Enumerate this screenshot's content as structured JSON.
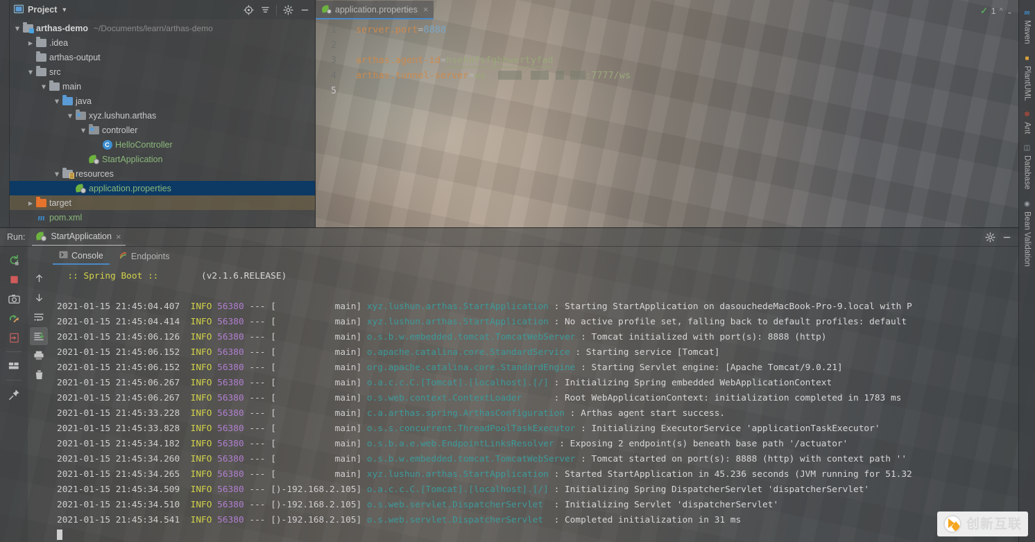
{
  "left_stripe": {
    "labels": []
  },
  "project": {
    "title": "Project",
    "dropdown_icon": "chevron-down-icon",
    "panel_icon": "project-panel-icon",
    "toolbar": [
      {
        "name": "locate-icon",
        "label": "locate"
      },
      {
        "name": "collapse-all-icon",
        "label": "collapse-all"
      },
      {
        "name": "gear-icon",
        "label": "settings"
      },
      {
        "name": "minimize-icon",
        "label": "hide"
      }
    ],
    "tree": [
      {
        "indent": 0,
        "arrow": "down",
        "icon": "module-folder-icon",
        "label": "arthas-demo",
        "sub": "~/Documents/learn/arthas-demo",
        "style": "root"
      },
      {
        "indent": 1,
        "arrow": "right",
        "icon": "folder-icon",
        "label": ".idea",
        "sub": "",
        "style": ""
      },
      {
        "indent": 1,
        "arrow": "none",
        "icon": "folder-icon",
        "label": "arthas-output",
        "sub": "",
        "style": ""
      },
      {
        "indent": 1,
        "arrow": "down",
        "icon": "folder-icon",
        "label": "src",
        "sub": "",
        "style": ""
      },
      {
        "indent": 2,
        "arrow": "down",
        "icon": "folder-icon",
        "label": "main",
        "sub": "",
        "style": ""
      },
      {
        "indent": 3,
        "arrow": "down",
        "icon": "source-folder-icon",
        "label": "java",
        "sub": "",
        "style": ""
      },
      {
        "indent": 4,
        "arrow": "down",
        "icon": "package-icon",
        "label": "xyz.lushun.arthas",
        "sub": "",
        "style": ""
      },
      {
        "indent": 5,
        "arrow": "down",
        "icon": "package-icon",
        "label": "controller",
        "sub": "",
        "style": ""
      },
      {
        "indent": 6,
        "arrow": "none",
        "icon": "java-class-icon",
        "label": "HelloController",
        "sub": "",
        "style": "green"
      },
      {
        "indent": 5,
        "arrow": "none",
        "icon": "spring-bean-icon",
        "label": "StartApplication",
        "sub": "",
        "style": "green"
      },
      {
        "indent": 3,
        "arrow": "down",
        "icon": "resources-folder-icon",
        "label": "resources",
        "sub": "",
        "style": ""
      },
      {
        "indent": 4,
        "arrow": "none",
        "icon": "spring-properties-icon",
        "label": "application.properties",
        "sub": "",
        "style": "selected"
      },
      {
        "indent": 1,
        "arrow": "right",
        "icon": "excluded-folder-icon",
        "label": "target",
        "sub": "",
        "style": "highlight"
      },
      {
        "indent": 1,
        "arrow": "none",
        "icon": "maven-icon",
        "label": "pom.xml",
        "sub": "",
        "style": "green"
      }
    ]
  },
  "editor": {
    "tab": {
      "icon": "spring-properties-icon",
      "name": "application.properties",
      "close": "×"
    },
    "inspection_widget": {
      "check_icon": "inspection-ok-icon",
      "count": "1",
      "up": "⌃",
      "down": "⌄"
    },
    "lines": [
      {
        "no": "1",
        "tokens": [
          {
            "t": "key",
            "v": "server.port"
          },
          {
            "t": "eq",
            "v": "="
          },
          {
            "t": "num",
            "v": "8888"
          }
        ]
      },
      {
        "no": "2",
        "tokens": []
      },
      {
        "no": "3",
        "tokens": [
          {
            "t": "key",
            "v": "arthas.agent-id"
          },
          {
            "t": "eq",
            "v": "="
          },
          {
            "t": "wavy",
            "v": "hsehdfsfghhwertyfad"
          }
        ]
      },
      {
        "no": "4",
        "tokens": [
          {
            "t": "key",
            "v": "arthas.tunnel-server"
          },
          {
            "t": "eq",
            "v": "="
          },
          {
            "t": "val",
            "v": "ws"
          },
          {
            "t": "redact",
            "v": ""
          },
          {
            "t": "val",
            "v": ":7777/ws"
          }
        ]
      },
      {
        "no": "5",
        "tokens": [],
        "current": true
      }
    ]
  },
  "run_panel": {
    "label": "Run:",
    "config": {
      "icon": "spring-boot-icon",
      "name": "StartApplication",
      "close": "×"
    },
    "header_right": [
      {
        "name": "gear-icon",
        "label": "settings"
      },
      {
        "name": "minimize-icon",
        "label": "hide"
      }
    ],
    "left_toolbar": [
      {
        "name": "rerun-icon",
        "label": "Rerun"
      },
      {
        "name": "stop-icon",
        "label": "Stop"
      },
      {
        "name": "camera-icon",
        "label": "Dump Threads"
      },
      {
        "name": "restart-icon",
        "label": "Restart"
      },
      {
        "name": "exit-icon",
        "label": "Exit"
      },
      {
        "name": "layout-icon",
        "label": "Layout"
      },
      {
        "name": "pin-icon",
        "label": "Pin Tab"
      }
    ],
    "second_toolbar": [
      {
        "name": "up-arrow-icon",
        "label": "Up the Stack Trace"
      },
      {
        "name": "down-arrow-icon",
        "label": "Down the Stack Trace"
      },
      {
        "name": "soft-wrap-icon",
        "label": "Soft-Wrap"
      },
      {
        "name": "scroll-end-icon",
        "label": "Scroll to End",
        "active": true
      },
      {
        "name": "print-icon",
        "label": "Print"
      },
      {
        "name": "trash-icon",
        "label": "Clear All"
      }
    ],
    "tabs": [
      {
        "icon": "console-icon",
        "label": "Console",
        "active": true
      },
      {
        "icon": "endpoints-icon",
        "label": "Endpoints",
        "active": false
      }
    ],
    "console": {
      "banner": {
        "text": ":: Spring Boot ::",
        "version": "(v2.1.6.RELEASE)"
      },
      "lines": [
        {
          "ts": "2021-01-15 21:45:04.407",
          "lvl": "INFO",
          "pid": "56380",
          "thread": "main",
          "logger": "xyz.lushun.arthas.StartApplication",
          "msg": "Starting StartApplication on dasouchedeMacBook-Pro-9.local with P"
        },
        {
          "ts": "2021-01-15 21:45:04.414",
          "lvl": "INFO",
          "pid": "56380",
          "thread": "main",
          "logger": "xyz.lushun.arthas.StartApplication",
          "msg": "No active profile set, falling back to default profiles: default"
        },
        {
          "ts": "2021-01-15 21:45:06.126",
          "lvl": "INFO",
          "pid": "56380",
          "thread": "main",
          "logger": "o.s.b.w.embedded.tomcat.TomcatWebServer",
          "msg": "Tomcat initialized with port(s): 8888 (http)"
        },
        {
          "ts": "2021-01-15 21:45:06.152",
          "lvl": "INFO",
          "pid": "56380",
          "thread": "main",
          "logger": "o.apache.catalina.core.StandardService",
          "msg": "Starting service [Tomcat]"
        },
        {
          "ts": "2021-01-15 21:45:06.152",
          "lvl": "INFO",
          "pid": "56380",
          "thread": "main",
          "logger": "org.apache.catalina.core.StandardEngine",
          "msg": "Starting Servlet engine: [Apache Tomcat/9.0.21]"
        },
        {
          "ts": "2021-01-15 21:45:06.267",
          "lvl": "INFO",
          "pid": "56380",
          "thread": "main",
          "logger": "o.a.c.c.C.[Tomcat].[localhost].[/]",
          "msg": "Initializing Spring embedded WebApplicationContext"
        },
        {
          "ts": "2021-01-15 21:45:06.267",
          "lvl": "INFO",
          "pid": "56380",
          "thread": "main",
          "logger": "o.s.web.context.ContextLoader",
          "msg": "Root WebApplicationContext: initialization completed in 1783 ms"
        },
        {
          "ts": "2021-01-15 21:45:33.228",
          "lvl": "INFO",
          "pid": "56380",
          "thread": "main",
          "logger": "c.a.arthas.spring.ArthasConfiguration",
          "msg": "Arthas agent start success."
        },
        {
          "ts": "2021-01-15 21:45:33.828",
          "lvl": "INFO",
          "pid": "56380",
          "thread": "main",
          "logger": "o.s.s.concurrent.ThreadPoolTaskExecutor",
          "msg": "Initializing ExecutorService 'applicationTaskExecutor'"
        },
        {
          "ts": "2021-01-15 21:45:34.182",
          "lvl": "INFO",
          "pid": "56380",
          "thread": "main",
          "logger": "o.s.b.a.e.web.EndpointLinksResolver",
          "msg": "Exposing 2 endpoint(s) beneath base path '/actuator'"
        },
        {
          "ts": "2021-01-15 21:45:34.260",
          "lvl": "INFO",
          "pid": "56380",
          "thread": "main",
          "logger": "o.s.b.w.embedded.tomcat.TomcatWebServer",
          "msg": "Tomcat started on port(s): 8888 (http) with context path ''"
        },
        {
          "ts": "2021-01-15 21:45:34.265",
          "lvl": "INFO",
          "pid": "56380",
          "thread": "main",
          "logger": "xyz.lushun.arthas.StartApplication",
          "msg": "Started StartApplication in 45.236 seconds (JVM running for 51.32"
        },
        {
          "ts": "2021-01-15 21:45:34.509",
          "lvl": "INFO",
          "pid": "56380",
          "thread": ")-192.168.2.105",
          "logger": "o.a.c.c.C.[Tomcat].[localhost].[/]",
          "msg": "Initializing Spring DispatcherServlet 'dispatcherServlet'"
        },
        {
          "ts": "2021-01-15 21:45:34.510",
          "lvl": "INFO",
          "pid": "56380",
          "thread": ")-192.168.2.105",
          "logger": "o.s.web.servlet.DispatcherServlet",
          "msg": "Initializing Servlet 'dispatcherServlet'"
        },
        {
          "ts": "2021-01-15 21:45:34.541",
          "lvl": "INFO",
          "pid": "56380",
          "thread": ")-192.168.2.105",
          "logger": "o.s.web.servlet.DispatcherServlet",
          "msg": "Completed initialization in 31 ms"
        }
      ]
    }
  },
  "right_stripe": {
    "tabs": [
      {
        "icon": "maven-icon",
        "label": "Maven"
      },
      {
        "icon": "plantuml-icon",
        "label": "PlantUML"
      },
      {
        "icon": "ant-icon",
        "label": "Ant"
      },
      {
        "icon": "database-icon",
        "label": "Database"
      },
      {
        "icon": "bean-validation-icon",
        "label": "Bean Validation"
      }
    ]
  },
  "watermark": {
    "text": "创新互联",
    "logo": "chuangxin-logo-icon"
  },
  "colors": {
    "accent_blue": "#4a88c7",
    "selection_blue": "#0d3a64",
    "panel_bg": "#3c3f41",
    "log_logger": "#3c9a9a",
    "log_level": "#d2d24a",
    "log_pid": "#b07fd0",
    "key_orange": "#cc8a4e",
    "value_green": "#9aa87a",
    "number_blue": "#7aa7c7"
  }
}
